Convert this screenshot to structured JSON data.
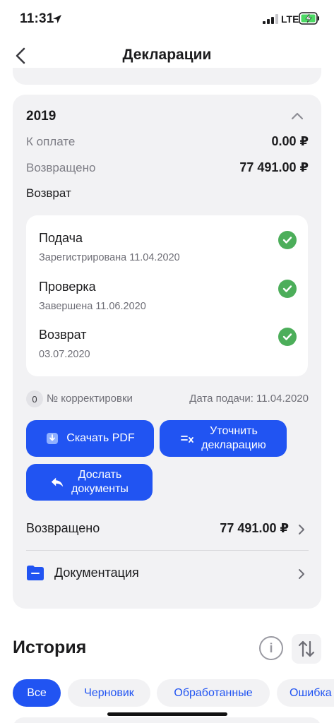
{
  "status_bar": {
    "time": "11:31",
    "network": "LTE"
  },
  "nav": {
    "title": "Декларации"
  },
  "declaration": {
    "year": "2019",
    "rows": [
      {
        "label": "К оплате",
        "value": "0.00 ₽"
      },
      {
        "label": "Возвращено",
        "value": "77 491.00 ₽"
      }
    ],
    "section_label": "Возврат",
    "steps": [
      {
        "title": "Подача",
        "subtitle": "Зарегистрирована 11.04.2020",
        "done": true
      },
      {
        "title": "Проверка",
        "subtitle": "Завершена 11.06.2020",
        "done": true
      },
      {
        "title": "Возврат",
        "subtitle": "03.07.2020",
        "done": true
      }
    ],
    "correction_count": "0",
    "correction_label": "№ корректировки",
    "filing_date": "Дата подачи: 11.04.2020",
    "buttons": {
      "download": "Скачать PDF",
      "clarify": "Уточнить\nдекларацию",
      "send_docs": "Дослать\nдокументы"
    },
    "returned_link": {
      "label": "Возвращено",
      "value": "77 491.00 ₽"
    },
    "documentation_link": {
      "label": "Документация"
    }
  },
  "history": {
    "title": "История",
    "filters": [
      "Все",
      "Черновик",
      "Обработанные",
      "Ошибка"
    ],
    "active_filter": "Все"
  },
  "colors": {
    "accent": "#2154f2",
    "success": "#4cae5a",
    "card_bg": "#f2f2f4"
  }
}
